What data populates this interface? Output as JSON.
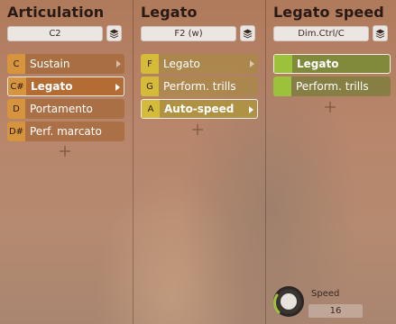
{
  "columns": {
    "articulation": {
      "title": "Articulation",
      "selector": "C2",
      "items": [
        {
          "key": "C",
          "label": "Sustain",
          "has_arrow": true
        },
        {
          "key": "C#",
          "label": "Legato",
          "has_arrow": true,
          "selected": true
        },
        {
          "key": "D",
          "label": "Portamento",
          "has_arrow": false
        },
        {
          "key": "D#",
          "label": "Perf. marcato",
          "has_arrow": false
        }
      ]
    },
    "legato": {
      "title": "Legato",
      "selector": "F2 (w)",
      "items": [
        {
          "key": "F",
          "label": "Legato",
          "has_arrow": true
        },
        {
          "key": "G",
          "label": "Perform. trills",
          "has_arrow": false
        },
        {
          "key": "A",
          "label": "Auto-speed",
          "has_arrow": true,
          "selected": true
        }
      ]
    },
    "speed": {
      "title": "Legato speed",
      "selector": "Dim.Ctrl/C",
      "items": [
        {
          "key": "",
          "label": "Legato",
          "selected": true
        },
        {
          "key": "",
          "label": "Perform. trills"
        }
      ]
    }
  },
  "speed_control": {
    "label": "Speed",
    "value": "16"
  },
  "colors": {
    "articulation_key": "#d7943e",
    "legato_key": "#d4bb3a",
    "speed_key": "#9cc23c",
    "knob_accent": "#9cc23c"
  },
  "icons": {
    "selector_button": "layers-icon",
    "add": "plus-icon",
    "submenu": "chevron-right-icon"
  }
}
